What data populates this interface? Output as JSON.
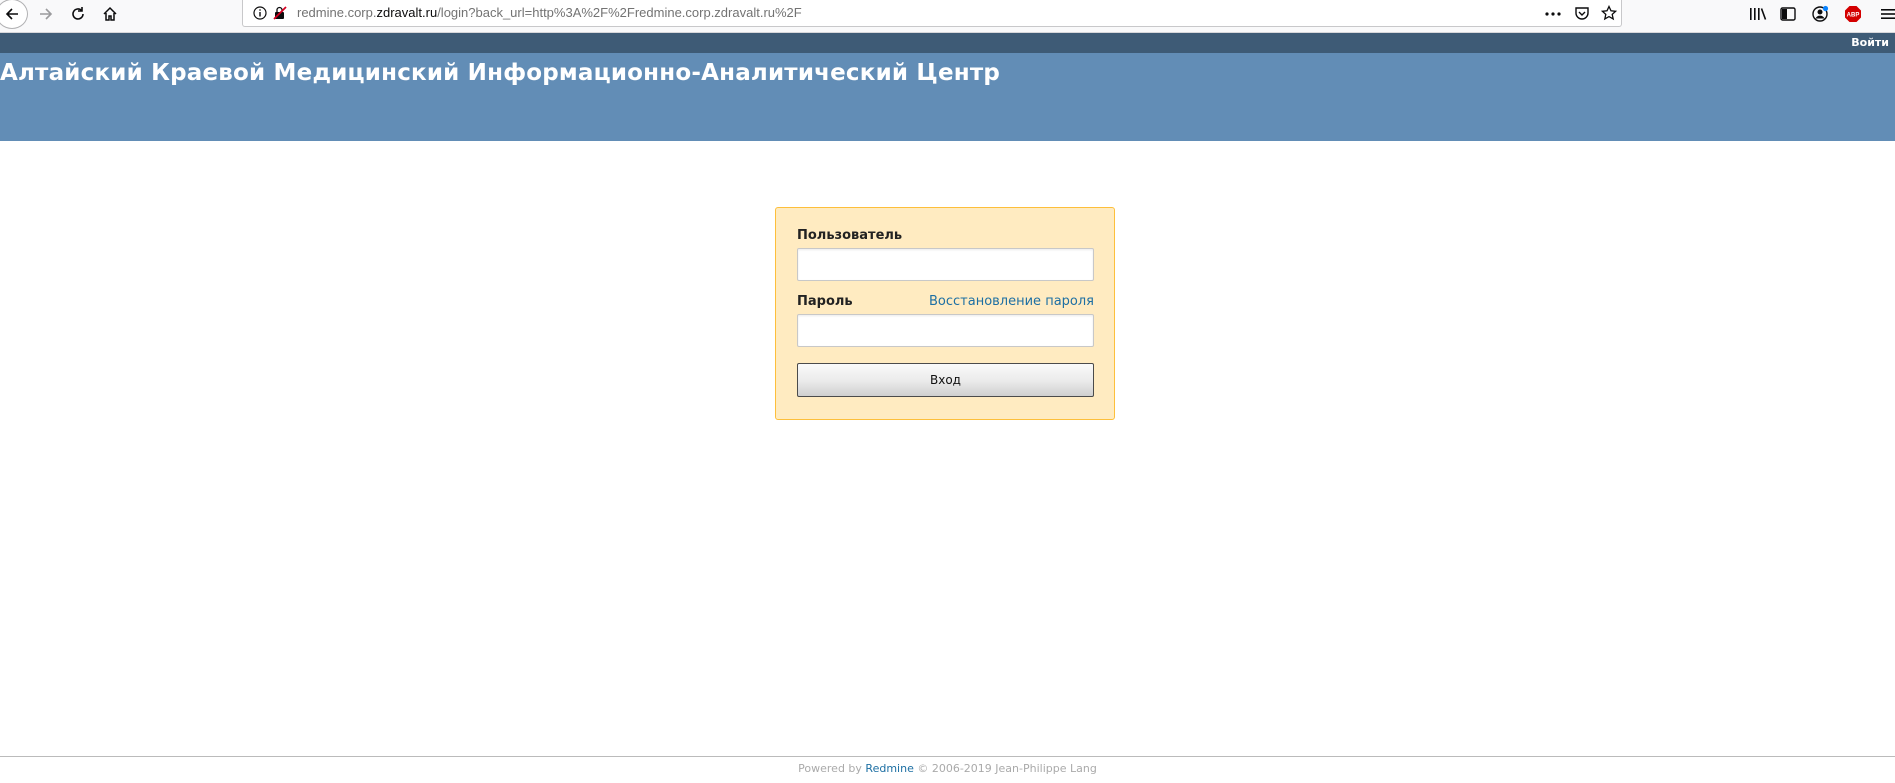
{
  "browser": {
    "url_prefix": "redmine.corp.",
    "url_domain": "zdravalt.ru",
    "url_suffix": "/login?back_url=http%3A%2F%2Fredmine.corp.zdravalt.ru%2F",
    "icons": {
      "back": "arrow-left-icon",
      "forward": "arrow-right-icon",
      "reload": "reload-icon",
      "home": "home-icon",
      "info": "info-icon",
      "insecure": "insecure-lock-icon",
      "more": "more-icon",
      "pocket": "pocket-icon",
      "bookmark": "star-icon",
      "library": "library-icon",
      "sidebar": "sidebar-icon",
      "account": "account-icon",
      "adblock": "adblock-icon",
      "menu": "hamburger-icon"
    },
    "adblock_label": "ABP"
  },
  "top_menu": {
    "login_label": "Войти"
  },
  "header": {
    "title": "Алтайский Краевой Медицинский Информационно-Аналитический Центр"
  },
  "login_form": {
    "username_label": "Пользователь",
    "username_value": "",
    "password_label": "Пароль",
    "password_value": "",
    "lost_password_label": "Восстановление пароля",
    "submit_label": "Вход"
  },
  "footer": {
    "powered_by": "Powered by",
    "redmine_link": "Redmine",
    "copyright": "© 2006-2019 Jean-Philippe Lang"
  },
  "colors": {
    "top_menu_bg": "#3e5b76",
    "header_bg": "#628db6",
    "login_box_bg": "#ffebc1",
    "login_box_border": "#fdbf3b",
    "link": "#1d6fa3"
  }
}
